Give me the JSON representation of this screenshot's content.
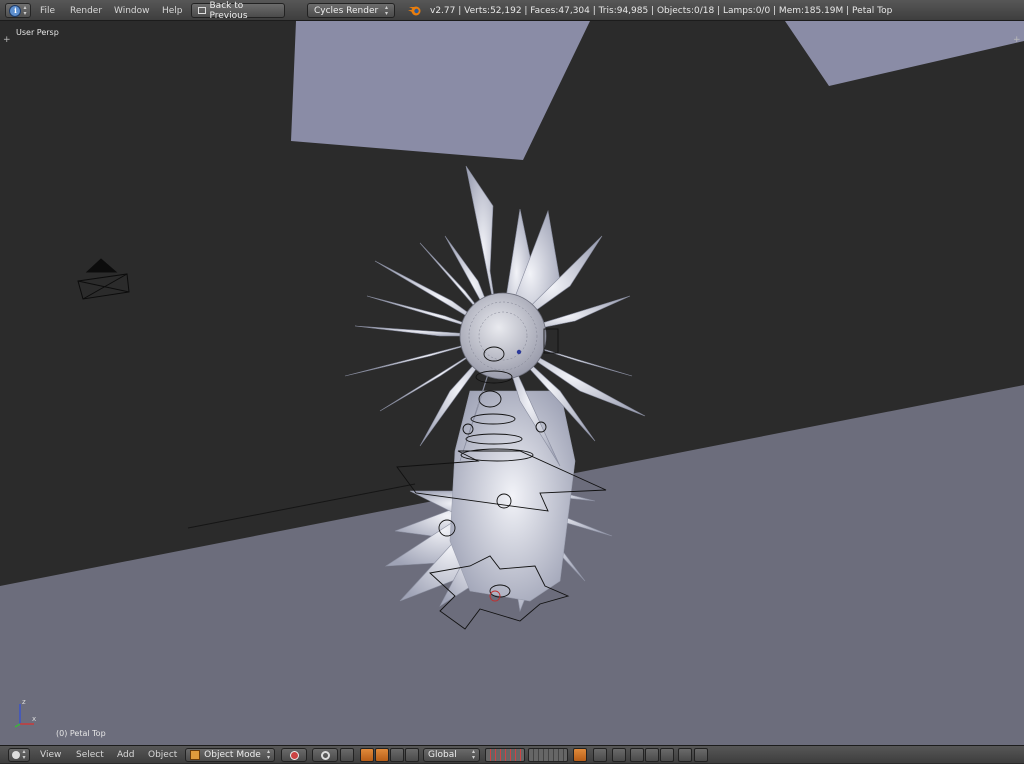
{
  "header": {
    "menus": [
      "File",
      "Render",
      "Window",
      "Help"
    ],
    "back_button": "Back to Previous",
    "render_engine": "Cycles Render",
    "stats": "v2.77 | Verts:52,192 | Faces:47,304 | Tris:94,985 | Objects:0/18 | Lamps:0/0 | Mem:185.19M | Petal Top"
  },
  "viewport": {
    "view_label": "User Persp",
    "object_label": "(0) Petal Top",
    "axis_x": "x",
    "axis_z": "z"
  },
  "footer": {
    "menus": [
      "View",
      "Select",
      "Add",
      "Object"
    ],
    "mode": "Object Mode",
    "orientation": "Global"
  },
  "colors": {
    "background": "#2b2b2b",
    "wall": "#8a8ca6",
    "floor": "#6c6d7c",
    "petal": "#d7d9e3",
    "header": "#4a4a4a",
    "accent_orange": "#d4732b"
  },
  "icons": [
    "info-editor-icon",
    "blender-logo-icon",
    "view3d-editor-icon",
    "object-mode-icon",
    "viewport-shading-icon",
    "pivot-icon",
    "manipulator-icon",
    "snap-icon",
    "render-preview-icon"
  ]
}
